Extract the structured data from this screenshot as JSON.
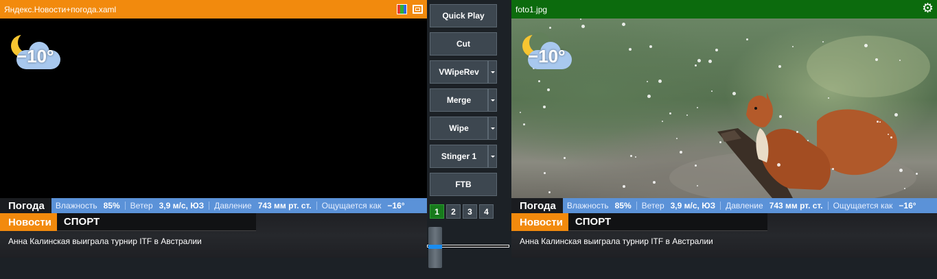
{
  "preview": {
    "title": "Яндекс.Новости+погода.xaml",
    "weather_temp": "−10°",
    "weather_bar": {
      "label": "Погода",
      "items": [
        {
          "key": "Влажность",
          "value": "85%"
        },
        {
          "key": "Ветер",
          "value": "3,9 м/с, ЮЗ"
        },
        {
          "key": "Давление",
          "value": "743 мм рт. ст."
        },
        {
          "key": "Ощущается как",
          "value": "−16°"
        }
      ]
    },
    "news": {
      "tag": "Новости",
      "category": "СПОРТ",
      "headline": "Анна Калинская выиграла турнир ITF в Австралии"
    }
  },
  "program": {
    "title": "foto1.jpg",
    "weather_temp": "−10°",
    "weather_bar": {
      "label": "Погода",
      "items": [
        {
          "key": "Влажность",
          "value": "85%"
        },
        {
          "key": "Ветер",
          "value": "3,9 м/с, ЮЗ"
        },
        {
          "key": "Давление",
          "value": "743 мм рт. ст."
        },
        {
          "key": "Ощущается как",
          "value": "−16°"
        }
      ]
    },
    "news": {
      "tag": "Новости",
      "category": "СПОРТ",
      "headline": "Анна Калинская выиграла турнир ITF в Австралии"
    }
  },
  "controls": {
    "quick_play": "Quick Play",
    "cut": "Cut",
    "vwiperev": "VWipeRev",
    "merge": "Merge",
    "wipe": "Wipe",
    "stinger": "Stinger 1",
    "ftb": "FTB",
    "banks": [
      "1",
      "2",
      "3",
      "4"
    ],
    "active_bank": "1",
    "tbar_position": 0.5
  },
  "colors": {
    "preview_bar": "#f28a0d",
    "program_bar": "#0c6b0d",
    "weather_strip": "#5b92d8",
    "news_tag": "#f28a0d",
    "active_bank": "#177a1c"
  },
  "icons": {
    "preview_title": [
      "color-bars-icon",
      "window-icon"
    ],
    "program_title": [
      "gear-icon"
    ],
    "weather": "moon-cloud-icon"
  }
}
